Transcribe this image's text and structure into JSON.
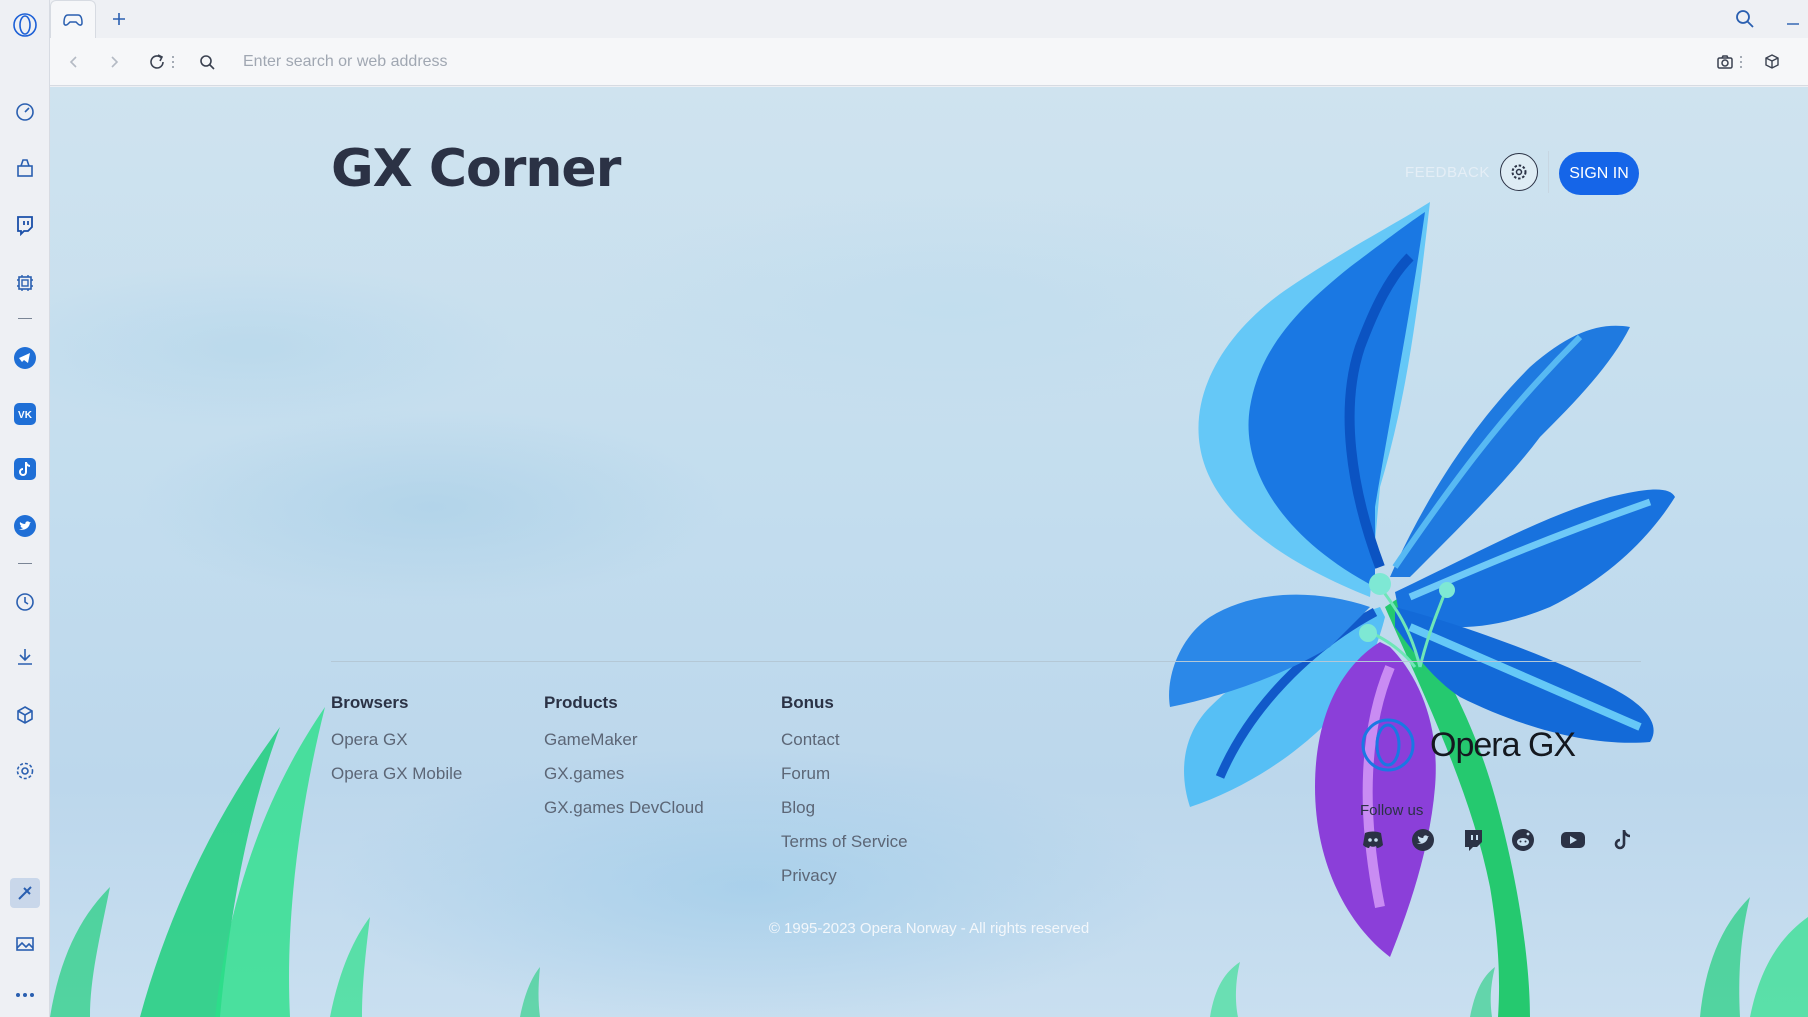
{
  "browser": {
    "address_placeholder": "Enter search or web address"
  },
  "page": {
    "title": "GX Corner",
    "feedback_label": "FEEDBACK",
    "signin_label": "SIGN IN"
  },
  "footer": {
    "columns": [
      {
        "heading": "Browsers",
        "links": [
          "Opera GX",
          "Opera GX Mobile"
        ]
      },
      {
        "heading": "Products",
        "links": [
          "GameMaker",
          "GX.games",
          "GX.games DevCloud"
        ]
      },
      {
        "heading": "Bonus",
        "links": [
          "Contact",
          "Forum",
          "Blog",
          "Terms of Service",
          "Privacy"
        ]
      }
    ],
    "brand_name": "Opera GX",
    "follow_label": "Follow us",
    "social_icons": [
      "discord-icon",
      "twitter-icon",
      "twitch-icon",
      "reddit-icon",
      "youtube-icon",
      "tiktok-icon"
    ],
    "copyright": "© 1995-2023 Opera Norway - All rights reserved"
  },
  "sidebar_icons": [
    "opera-logo-icon",
    "speed-dial-icon",
    "gx-control-icon",
    "twitch-icon",
    "hardware-monitor-icon",
    "telegram-icon",
    "vk-icon",
    "tiktok-icon",
    "twitter-icon",
    "history-icon",
    "downloads-icon",
    "extensions-icon",
    "settings-icon",
    "gx-cleaner-icon",
    "gallery-icon",
    "more-icon"
  ],
  "colors": {
    "accent": "#1565e8",
    "title": "#2b3245",
    "flower_blue": "#1f7ae0",
    "flower_purple": "#8b3fd9",
    "grass_green": "#1fcf7d"
  }
}
